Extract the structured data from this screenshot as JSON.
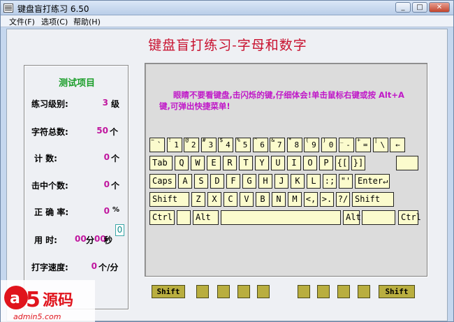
{
  "window": {
    "title": "键盘盲打练习 6.50",
    "min": "_",
    "max": "□",
    "close": "✕"
  },
  "menu": [
    {
      "label": "文件(F)"
    },
    {
      "label": "选项(C)"
    },
    {
      "label": "帮助(H)"
    }
  ],
  "app_title": "键盘盲打练习-字母和数字",
  "stats": {
    "heading": "测试项目",
    "level_label": "练习级别:",
    "level_value": "3",
    "level_unit": "级",
    "total_label": "字符总数:",
    "total_value": "50",
    "total_unit": "个",
    "count_label": "计    数:",
    "count_value": "0",
    "count_unit": "个",
    "hits_label": "击中个数:",
    "hits_value": "0",
    "hits_unit": "个",
    "accuracy_label": "正 确 率:",
    "accuracy_value": "0",
    "accuracy_unit": "%",
    "time_label": "用    时:",
    "time_min": "00",
    "time_min_unit": "分",
    "time_sec": "00",
    "time_sec_unit": "秒",
    "time_input": "0",
    "speed_label": "打字速度:",
    "speed_value": "0",
    "speed_unit": "个/分"
  },
  "hint": "眼睛不要看键盘,击闪烁的键,仔细体会!单击鼠标右键或按 Alt+A 键,可弹出快捷菜单!",
  "keyboard": {
    "row1": [
      {
        "top": "~",
        "main": "`"
      },
      {
        "top": "!",
        "main": "1"
      },
      {
        "top": "@",
        "main": "2"
      },
      {
        "top": "#",
        "main": "3"
      },
      {
        "top": "$",
        "main": "4"
      },
      {
        "top": "%",
        "main": "5"
      },
      {
        "top": "^",
        "main": "6"
      },
      {
        "top": "&",
        "main": "7"
      },
      {
        "top": "*",
        "main": "8"
      },
      {
        "top": "(",
        "main": "9"
      },
      {
        "top": ")",
        "main": "0"
      },
      {
        "top": "_",
        "main": "-"
      },
      {
        "top": "+",
        "main": "="
      },
      {
        "top": "|",
        "main": "\\"
      },
      {
        "top": "",
        "main": "←"
      }
    ],
    "row2": [
      "Tab",
      "Q",
      "W",
      "E",
      "R",
      "T",
      "Y",
      "U",
      "I",
      "O",
      "P",
      "{[",
      "}]"
    ],
    "row3": [
      "Caps",
      "A",
      "S",
      "D",
      "F",
      "G",
      "H",
      "J",
      "K",
      "L",
      ":;",
      "\"'",
      "Enter↵"
    ],
    "row4": [
      "Shift",
      "Z",
      "X",
      "C",
      "V",
      "B",
      "N",
      "M",
      "<,",
      ">.",
      "?/",
      "Shift"
    ],
    "row5": [
      "Ctrl",
      "",
      "Alt",
      "",
      "Alt",
      "",
      "Ctrl"
    ]
  },
  "bottom": {
    "shift_left": "Shift",
    "shift_right": "Shift"
  },
  "watermark": {
    "brand": "a5源码",
    "url": "admin5.com",
    "color": "#e0141c"
  }
}
